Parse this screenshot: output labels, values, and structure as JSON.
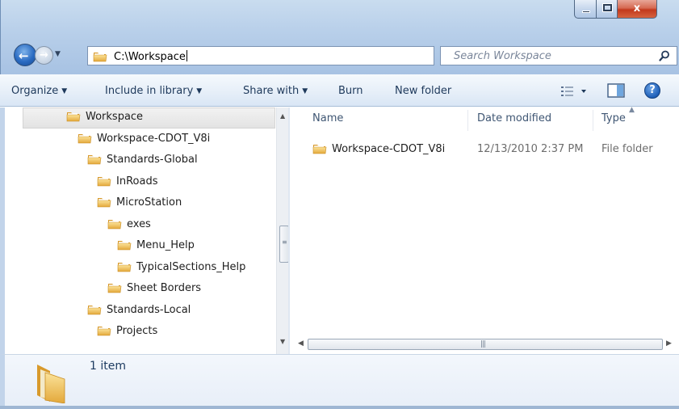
{
  "window": {
    "controls": {
      "minimize": "minimize",
      "maximize": "maximize",
      "close": "x"
    }
  },
  "nav": {
    "address": "C:\\Workspace",
    "search_placeholder": "Search Workspace"
  },
  "toolbar": {
    "organize": "Organize",
    "include_in_library": "Include in library",
    "share_with": "Share with",
    "burn": "Burn",
    "new_folder": "New folder"
  },
  "tree": {
    "items": [
      {
        "label": "Workspace",
        "level": 0,
        "selected": true
      },
      {
        "label": "Workspace-CDOT_V8i",
        "level": 1
      },
      {
        "label": "Standards-Global",
        "level": 2
      },
      {
        "label": "InRoads",
        "level": 3
      },
      {
        "label": "MicroStation",
        "level": 3
      },
      {
        "label": "exes",
        "level": 4
      },
      {
        "label": "Menu_Help",
        "level": 5
      },
      {
        "label": "TypicalSections_Help",
        "level": 5
      },
      {
        "label": "Sheet Borders",
        "level": 4
      },
      {
        "label": "Standards-Local",
        "level": 2
      },
      {
        "label": "Projects",
        "level": 3
      }
    ]
  },
  "list": {
    "columns": {
      "name": "Name",
      "date_modified": "Date modified",
      "type": "Type"
    },
    "rows": [
      {
        "name": "Workspace-CDOT_V8i",
        "date_modified": "12/13/2010 2:37 PM",
        "type": "File folder"
      }
    ]
  },
  "details": {
    "item_count": "1 item"
  },
  "icons": {
    "folder": "folder-icon",
    "search": "search-icon",
    "refresh": "refresh-icon",
    "help": "help-icon",
    "views": "views-icon",
    "preview_pane": "preview-pane-icon"
  },
  "colors": {
    "chrome": "#b9d0ea",
    "toolbar_text": "#1e395b",
    "folder": "#e8b84a",
    "close_button": "#c2391d"
  }
}
